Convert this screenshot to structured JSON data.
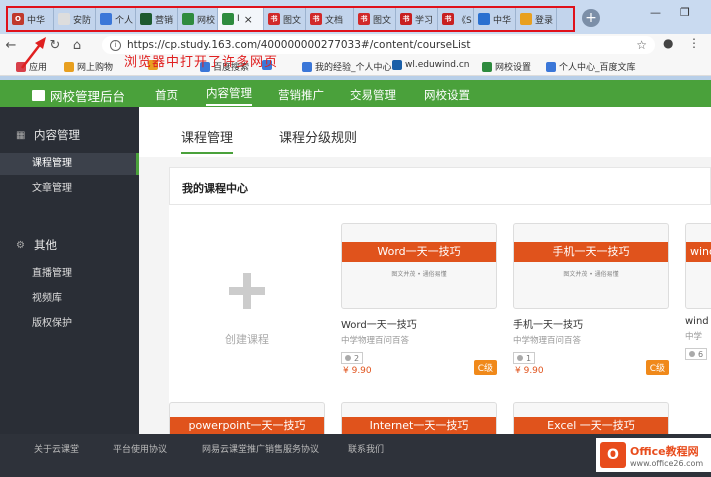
{
  "browser": {
    "tabs": [
      {
        "label": "中华",
        "fav": "O",
        "color": "#c0392b",
        "active": false
      },
      {
        "label": "安防",
        "fav": "",
        "color": "#dddddd",
        "active": false
      },
      {
        "label": "个人",
        "fav": "",
        "color": "#3b77d8",
        "active": false
      },
      {
        "label": "营销",
        "fav": "",
        "color": "#1d5a2e",
        "active": false
      },
      {
        "label": "网校",
        "fav": "",
        "color": "#2e8b3e",
        "active": false
      },
      {
        "label": "I",
        "fav": "",
        "color": "#2e8b3e",
        "active": true
      },
      {
        "label": "图文",
        "fav": "书",
        "color": "#d12a2a",
        "active": false
      },
      {
        "label": "文档",
        "fav": "书",
        "color": "#d12a2a",
        "active": false
      },
      {
        "label": "图文",
        "fav": "书",
        "color": "#d12a2a",
        "active": false
      },
      {
        "label": "学习",
        "fav": "书",
        "color": "#c82020",
        "active": false
      },
      {
        "label": "《S",
        "fav": "书",
        "color": "#c82020",
        "active": false
      },
      {
        "label": "中华",
        "fav": "",
        "color": "#2a70d0",
        "active": false
      },
      {
        "label": "登录",
        "fav": "",
        "color": "#e8a020",
        "active": false
      }
    ],
    "new_tab": "+",
    "win_min": "—",
    "win_max": "❐",
    "url": "https://cp.study.163.com/400000000277033#/content/courseList",
    "bookmarks": [
      {
        "label": "应用",
        "color": "#d8404a"
      },
      {
        "label": "网上购物",
        "color": "#e8a020"
      },
      {
        "label": "",
        "color": "#e8a020"
      },
      {
        "label": "百度搜索",
        "color": "#3b77d8"
      },
      {
        "label": "",
        "color": "#3b77d8"
      },
      {
        "label": "我的经验_个人中心",
        "color": "#3b77d8"
      },
      {
        "label": "wl.eduwind.cn",
        "color": "#1a5fa8"
      },
      {
        "label": "网校设置",
        "color": "#2e8b3e"
      },
      {
        "label": "个人中心_百度文库",
        "color": "#3b77d8"
      }
    ]
  },
  "annotation": "浏览器中打开了许多网页",
  "site": {
    "logo": "网校管理后台",
    "nav": [
      "首页",
      "内容管理",
      "营销推广",
      "交易管理",
      "网校设置"
    ],
    "nav_active": 1
  },
  "sidebar": {
    "section1": "内容管理",
    "items1": [
      "课程管理",
      "文章管理"
    ],
    "section2": "其他",
    "items2": [
      "直播管理",
      "视频库",
      "版权保护"
    ]
  },
  "main": {
    "subtabs": [
      "课程管理",
      "课程分级规则"
    ],
    "panel_title": "我的课程中心",
    "create_label": "创建课程",
    "courses": [
      {
        "thumb": "Word一天一技巧",
        "sub": "图文并茂 • 通俗易懂",
        "name": "Word一天一技巧",
        "org": "中学物理百问百答",
        "students": "2",
        "price": "¥ 9.90",
        "level": "C级"
      },
      {
        "thumb": "手机一天一技巧",
        "sub": "图文并茂 • 通俗易懂",
        "name": "手机一天一技巧",
        "org": "中学物理百问百答",
        "students": "1",
        "price": "¥ 9.90",
        "level": "C级"
      },
      {
        "thumb": "wind",
        "sub": "",
        "name": "wind",
        "org": "中学",
        "students": "6",
        "price": "",
        "level": ""
      }
    ],
    "courses_row2": [
      "powerpoint一天一技巧",
      "Internet一天一技巧",
      "Excel 一天一技巧"
    ]
  },
  "footer": [
    "关于云课堂",
    "平台使用协议",
    "网易云课堂推广销售服务协议",
    "联系我们"
  ],
  "watermark": {
    "icon": "O",
    "title": "Office教程网",
    "url": "www.office26.com"
  },
  "colors": {
    "brand_green": "#4aa13b",
    "accent_orange": "#e0531c",
    "annotation_red": "#e02020"
  }
}
